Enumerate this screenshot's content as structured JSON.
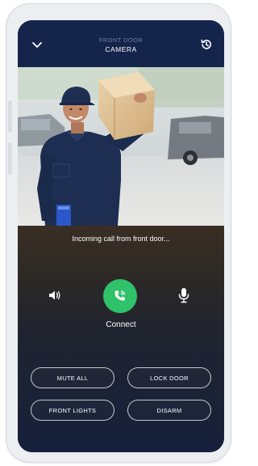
{
  "header": {
    "subtitle": "FRONT DOOR",
    "title": "CAMERA",
    "back_icon": "chevron-down-icon",
    "history_icon": "history-icon"
  },
  "call": {
    "status_text": "Incoming call from front door...",
    "connect_label": "Connect",
    "speaker_icon": "speaker-icon",
    "mic_icon": "microphone-icon",
    "connect_color": "#30c26a"
  },
  "actions": {
    "mute_all": "MUTE ALL",
    "lock_door": "LOCK DOOR",
    "front_lights": "FRONT LIGHTS",
    "disarm": "DISARM"
  },
  "colors": {
    "header_bg": "#15244b",
    "screen_bg": "#16203a"
  }
}
